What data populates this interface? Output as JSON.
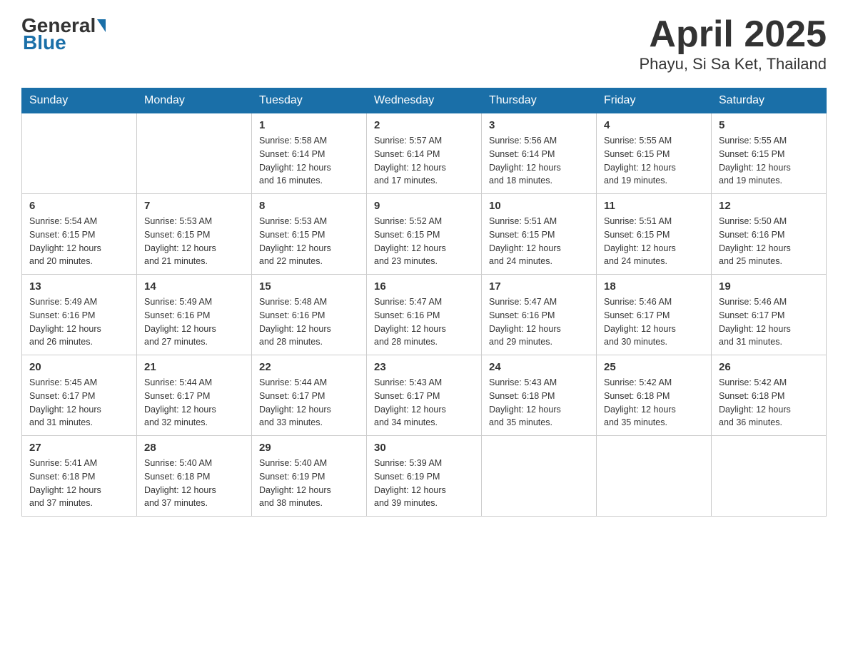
{
  "header": {
    "logo_general": "General",
    "logo_blue": "Blue",
    "month_title": "April 2025",
    "location": "Phayu, Si Sa Ket, Thailand"
  },
  "calendar": {
    "days_of_week": [
      "Sunday",
      "Monday",
      "Tuesday",
      "Wednesday",
      "Thursday",
      "Friday",
      "Saturday"
    ],
    "weeks": [
      [
        {
          "day": "",
          "info": ""
        },
        {
          "day": "",
          "info": ""
        },
        {
          "day": "1",
          "info": "Sunrise: 5:58 AM\nSunset: 6:14 PM\nDaylight: 12 hours\nand 16 minutes."
        },
        {
          "day": "2",
          "info": "Sunrise: 5:57 AM\nSunset: 6:14 PM\nDaylight: 12 hours\nand 17 minutes."
        },
        {
          "day": "3",
          "info": "Sunrise: 5:56 AM\nSunset: 6:14 PM\nDaylight: 12 hours\nand 18 minutes."
        },
        {
          "day": "4",
          "info": "Sunrise: 5:55 AM\nSunset: 6:15 PM\nDaylight: 12 hours\nand 19 minutes."
        },
        {
          "day": "5",
          "info": "Sunrise: 5:55 AM\nSunset: 6:15 PM\nDaylight: 12 hours\nand 19 minutes."
        }
      ],
      [
        {
          "day": "6",
          "info": "Sunrise: 5:54 AM\nSunset: 6:15 PM\nDaylight: 12 hours\nand 20 minutes."
        },
        {
          "day": "7",
          "info": "Sunrise: 5:53 AM\nSunset: 6:15 PM\nDaylight: 12 hours\nand 21 minutes."
        },
        {
          "day": "8",
          "info": "Sunrise: 5:53 AM\nSunset: 6:15 PM\nDaylight: 12 hours\nand 22 minutes."
        },
        {
          "day": "9",
          "info": "Sunrise: 5:52 AM\nSunset: 6:15 PM\nDaylight: 12 hours\nand 23 minutes."
        },
        {
          "day": "10",
          "info": "Sunrise: 5:51 AM\nSunset: 6:15 PM\nDaylight: 12 hours\nand 24 minutes."
        },
        {
          "day": "11",
          "info": "Sunrise: 5:51 AM\nSunset: 6:15 PM\nDaylight: 12 hours\nand 24 minutes."
        },
        {
          "day": "12",
          "info": "Sunrise: 5:50 AM\nSunset: 6:16 PM\nDaylight: 12 hours\nand 25 minutes."
        }
      ],
      [
        {
          "day": "13",
          "info": "Sunrise: 5:49 AM\nSunset: 6:16 PM\nDaylight: 12 hours\nand 26 minutes."
        },
        {
          "day": "14",
          "info": "Sunrise: 5:49 AM\nSunset: 6:16 PM\nDaylight: 12 hours\nand 27 minutes."
        },
        {
          "day": "15",
          "info": "Sunrise: 5:48 AM\nSunset: 6:16 PM\nDaylight: 12 hours\nand 28 minutes."
        },
        {
          "day": "16",
          "info": "Sunrise: 5:47 AM\nSunset: 6:16 PM\nDaylight: 12 hours\nand 28 minutes."
        },
        {
          "day": "17",
          "info": "Sunrise: 5:47 AM\nSunset: 6:16 PM\nDaylight: 12 hours\nand 29 minutes."
        },
        {
          "day": "18",
          "info": "Sunrise: 5:46 AM\nSunset: 6:17 PM\nDaylight: 12 hours\nand 30 minutes."
        },
        {
          "day": "19",
          "info": "Sunrise: 5:46 AM\nSunset: 6:17 PM\nDaylight: 12 hours\nand 31 minutes."
        }
      ],
      [
        {
          "day": "20",
          "info": "Sunrise: 5:45 AM\nSunset: 6:17 PM\nDaylight: 12 hours\nand 31 minutes."
        },
        {
          "day": "21",
          "info": "Sunrise: 5:44 AM\nSunset: 6:17 PM\nDaylight: 12 hours\nand 32 minutes."
        },
        {
          "day": "22",
          "info": "Sunrise: 5:44 AM\nSunset: 6:17 PM\nDaylight: 12 hours\nand 33 minutes."
        },
        {
          "day": "23",
          "info": "Sunrise: 5:43 AM\nSunset: 6:17 PM\nDaylight: 12 hours\nand 34 minutes."
        },
        {
          "day": "24",
          "info": "Sunrise: 5:43 AM\nSunset: 6:18 PM\nDaylight: 12 hours\nand 35 minutes."
        },
        {
          "day": "25",
          "info": "Sunrise: 5:42 AM\nSunset: 6:18 PM\nDaylight: 12 hours\nand 35 minutes."
        },
        {
          "day": "26",
          "info": "Sunrise: 5:42 AM\nSunset: 6:18 PM\nDaylight: 12 hours\nand 36 minutes."
        }
      ],
      [
        {
          "day": "27",
          "info": "Sunrise: 5:41 AM\nSunset: 6:18 PM\nDaylight: 12 hours\nand 37 minutes."
        },
        {
          "day": "28",
          "info": "Sunrise: 5:40 AM\nSunset: 6:18 PM\nDaylight: 12 hours\nand 37 minutes."
        },
        {
          "day": "29",
          "info": "Sunrise: 5:40 AM\nSunset: 6:19 PM\nDaylight: 12 hours\nand 38 minutes."
        },
        {
          "day": "30",
          "info": "Sunrise: 5:39 AM\nSunset: 6:19 PM\nDaylight: 12 hours\nand 39 minutes."
        },
        {
          "day": "",
          "info": ""
        },
        {
          "day": "",
          "info": ""
        },
        {
          "day": "",
          "info": ""
        }
      ]
    ]
  }
}
